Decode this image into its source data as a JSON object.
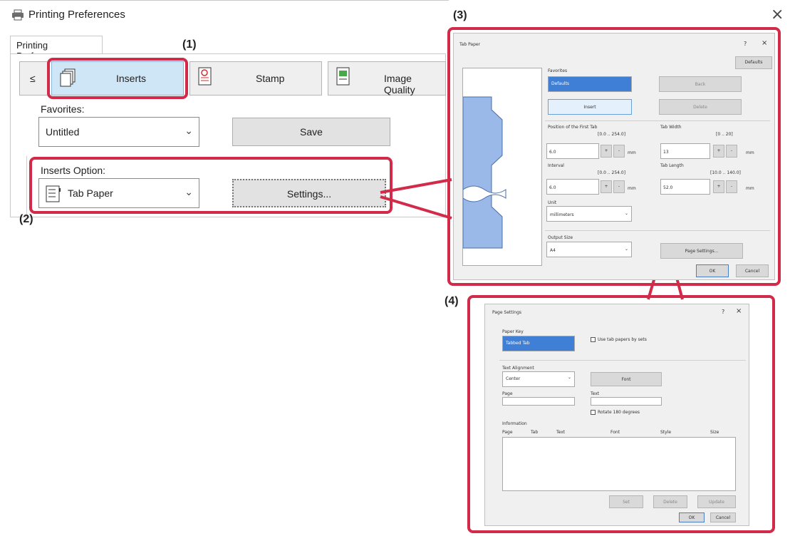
{
  "window": {
    "title": "Printing Preferences",
    "close_glyph": "×",
    "icon": "printer-icon"
  },
  "tab": {
    "label": "Printing Preferences"
  },
  "features": {
    "nav_glyph": "≤",
    "items": [
      {
        "label": "Inserts",
        "icon": "inserts-icon"
      },
      {
        "label": "Stamp",
        "icon": "stamp-icon"
      },
      {
        "label": "Image Quality",
        "icon": "image-quality-icon"
      }
    ]
  },
  "favorites": {
    "label": "Favorites:",
    "value": "Untitled",
    "save": "Save"
  },
  "inserts": {
    "label": "Inserts Option:",
    "value": "Tab Paper",
    "settings": "Settings..."
  },
  "steps": {
    "s1": "(1)",
    "s2": "(2)",
    "s3": "(3)",
    "s4": "(4)"
  },
  "tab_paper": {
    "title": "Tab Paper",
    "help": "?",
    "close": "×",
    "defaults": "Defaults",
    "favorites_label": "Favorites",
    "favorites_value": "Defaults",
    "insert_btn": "Insert",
    "back_btn": "Back",
    "delete_btn": "Delete",
    "position_label": "Position of the First Tab",
    "position_range": "[0.0 .. 254.0]",
    "position_value": "6.0",
    "interval_label": "Interval",
    "interval_range": "[0.0 .. 254.0]",
    "interval_value": "6.0",
    "tab_width_label": "Tab Width",
    "tab_width_range": "[0 .. 20]",
    "tab_width_value": "13",
    "tab_length_label": "Tab Length",
    "tab_length_range": "[10.0 .. 140.0]",
    "tab_length_value": "52.0",
    "unit_mm": "mm",
    "plus": "+",
    "minus": "-",
    "unit_label": "Unit",
    "unit_value": "millimeters",
    "output_size_label": "Output Size",
    "output_size_value": "A4",
    "page_settings_btn": "Page Settings...",
    "ok": "OK",
    "cancel": "Cancel"
  },
  "page_settings": {
    "title": "Page Settings",
    "help": "?",
    "close": "×",
    "paper_key_label": "Paper Key",
    "paper_key_value": "Tabbed Tab",
    "use_tab_label": "Use tab papers by sets",
    "text_alignment_label": "Text Alignment",
    "text_alignment_value": "Center",
    "font_btn": "Font",
    "page_label": "Page",
    "text_label": "Text",
    "rotate_label": "Rotate 180 degrees",
    "information_label": "Information",
    "columns": [
      "Page",
      "Tab",
      "Text",
      "Font",
      "Style",
      "Size"
    ],
    "set_btn": "Set",
    "delete_btn": "Delete",
    "update_btn": "Update",
    "ok": "OK",
    "cancel": "Cancel"
  },
  "colors": {
    "highlight": "#d22b4a",
    "active_tab": "#cfe6f7",
    "tab_fill": "#9ab8e8",
    "selection": "#3f7fd6"
  }
}
